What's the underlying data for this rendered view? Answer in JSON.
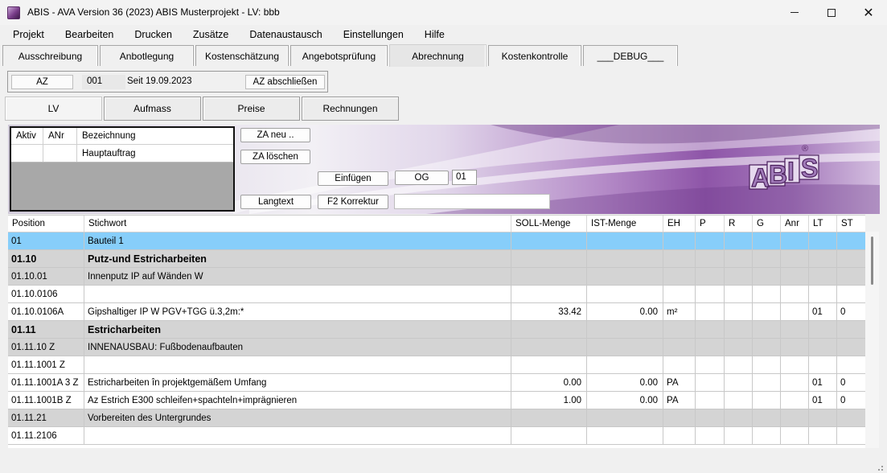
{
  "window": {
    "title": "ABIS - AVA Version 36 (2023) ABIS Musterprojekt - LV: bbb"
  },
  "menu": [
    "Projekt",
    "Bearbeiten",
    "Drucken",
    "Zusätze",
    "Datenaustausch",
    "Einstellungen",
    "Hilfe"
  ],
  "tabs": [
    "Ausschreibung",
    "Anbotlegung",
    "Kostenschätzung",
    "Angebotsprüfung",
    "Abrechnung",
    "Kostenkontrolle",
    "___DEBUG___"
  ],
  "active_tab": "Abrechnung",
  "az": {
    "label": "AZ",
    "number": "001",
    "since": "Seit 19.09.2023",
    "close_button": "AZ abschließen"
  },
  "subtabs": [
    "LV",
    "Aufmass",
    "Preise",
    "Rechnungen"
  ],
  "za_table": {
    "headers": [
      "Aktiv",
      "ANr",
      "Bezeichnung"
    ],
    "rows": [
      {
        "aktiv": "",
        "anr": "",
        "bezeichnung": "Hauptauftrag"
      }
    ]
  },
  "buttons": {
    "za_neu": "ZA neu ..",
    "za_loeschen": "ZA löschen",
    "einfuegen": "Einfügen",
    "og": "OG",
    "og_value": "01",
    "langtext": "Langtext",
    "f2_korrektur": "F2 Korrektur"
  },
  "logo": {
    "text": "ABIS",
    "reg": "®"
  },
  "grid": {
    "headers": [
      "Position",
      "Stichwort",
      "SOLL-Menge",
      "IST-Menge",
      "EH",
      "P",
      "R",
      "G",
      "Anr",
      "LT",
      "ST"
    ],
    "rows": [
      {
        "pos": "01",
        "stw": "Bauteil 1",
        "soll": "",
        "ist": "",
        "eh": "",
        "lt": "",
        "st": "",
        "style": "selected"
      },
      {
        "pos": "01.10",
        "stw": "Putz-und Estricharbeiten",
        "soll": "",
        "ist": "",
        "eh": "",
        "lt": "",
        "st": "",
        "style": "gray bold"
      },
      {
        "pos": "01.10.01",
        "stw": "Innenputz IP auf Wänden W",
        "soll": "",
        "ist": "",
        "eh": "",
        "lt": "",
        "st": "",
        "style": "gray"
      },
      {
        "pos": "01.10.0106",
        "stw": "",
        "soll": "",
        "ist": "",
        "eh": "",
        "lt": "",
        "st": "",
        "style": "white"
      },
      {
        "pos": "01.10.0106A",
        "stw": "Gipshaltiger IP W PGV+TGG  ü.3,2m:*",
        "soll": "33.42",
        "ist": "0.00",
        "eh": "m²",
        "lt": "01",
        "st": "0",
        "style": "white"
      },
      {
        "pos": "01.11",
        "stw": "Estricharbeiten",
        "soll": "",
        "ist": "",
        "eh": "",
        "lt": "",
        "st": "",
        "style": "gray bold"
      },
      {
        "pos": "01.11.10  Z",
        "stw": "INNENAUSBAU: Fußbodenaufbauten",
        "soll": "",
        "ist": "",
        "eh": "",
        "lt": "",
        "st": "",
        "style": "gray"
      },
      {
        "pos": "01.11.1001  Z",
        "stw": "",
        "soll": "",
        "ist": "",
        "eh": "",
        "lt": "",
        "st": "",
        "style": "white"
      },
      {
        "pos": "01.11.1001A 3  Z",
        "stw": "Estricharbeiten în projektgemäßem Umfang",
        "soll": "0.00",
        "ist": "0.00",
        "eh": "PA",
        "lt": "01",
        "st": "0",
        "style": "white"
      },
      {
        "pos": "01.11.1001B  Z",
        "stw": "Az Estrich E300 schleifen+spachteln+imprägnieren",
        "soll": "1.00",
        "ist": "0.00",
        "eh": "PA",
        "lt": "01",
        "st": "0",
        "style": "white"
      },
      {
        "pos": "01.11.21",
        "stw": "Vorbereiten des Untergrundes",
        "soll": "",
        "ist": "",
        "eh": "",
        "lt": "",
        "st": "",
        "style": "gray"
      },
      {
        "pos": "01.11.2106",
        "stw": "",
        "soll": "",
        "ist": "",
        "eh": "",
        "lt": "",
        "st": "",
        "style": "white"
      }
    ]
  },
  "colors": {
    "selected_row": "#87cefa",
    "group_row": "#d4d4d4",
    "banner_purple": "#8e55a8"
  }
}
